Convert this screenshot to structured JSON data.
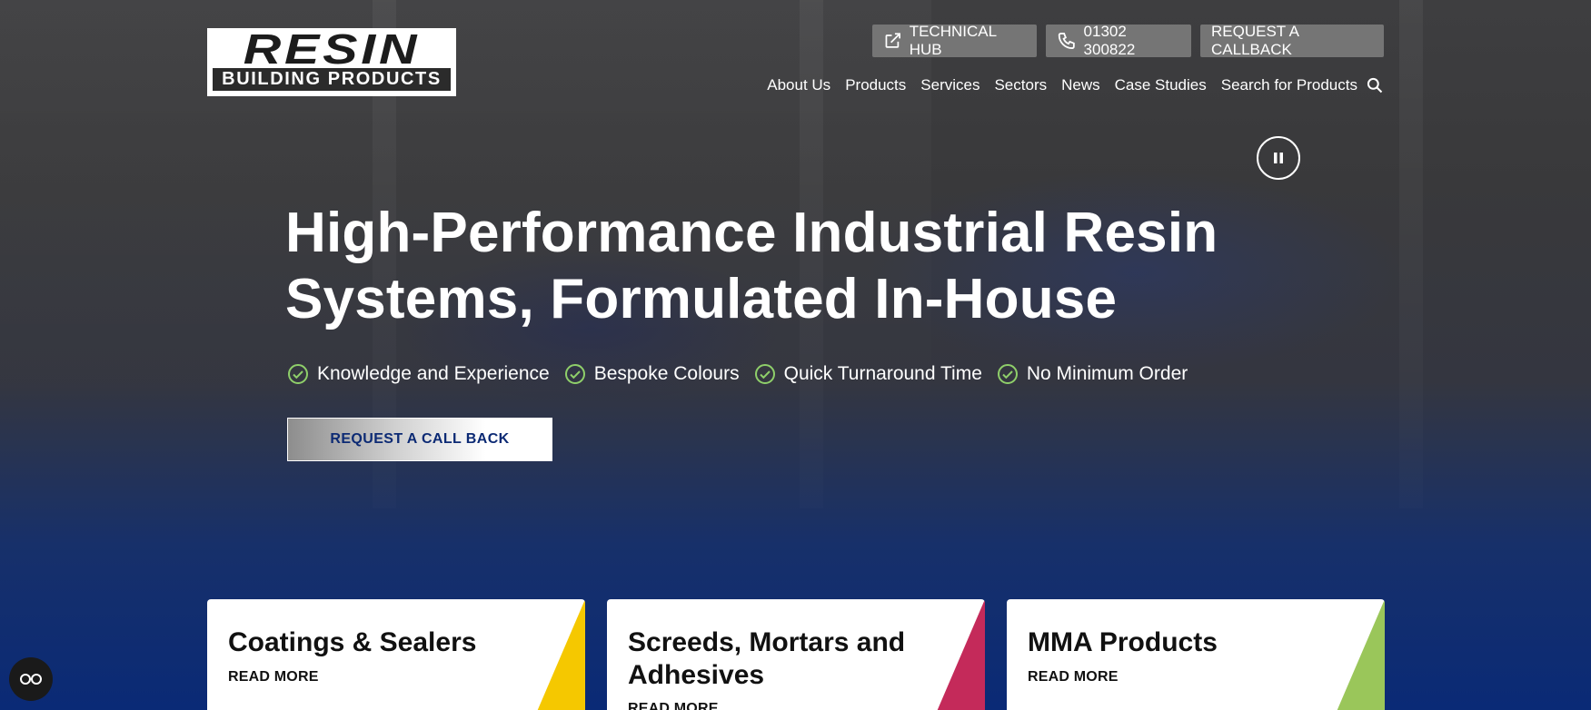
{
  "brand": {
    "logo_main": "RESIN",
    "logo_sub": "BUILDING PRODUCTS"
  },
  "utility": {
    "technical_hub": "TECHNICAL HUB",
    "phone": "01302 300822",
    "callback": "REQUEST A CALLBACK"
  },
  "nav": {
    "items": [
      {
        "label": "About Us"
      },
      {
        "label": "Products"
      },
      {
        "label": "Services"
      },
      {
        "label": "Sectors"
      },
      {
        "label": "News"
      },
      {
        "label": "Case Studies"
      },
      {
        "label": "Search for Products"
      }
    ]
  },
  "hero": {
    "headline_line1": "High-Performance Industrial Resin",
    "headline_line2": "Systems, Formulated In-House",
    "features": [
      {
        "label": "Knowledge and Experience"
      },
      {
        "label": "Bespoke Colours"
      },
      {
        "label": "Quick Turnaround Time"
      },
      {
        "label": "No Minimum Order"
      }
    ],
    "cta": "REQUEST A CALL BACK"
  },
  "cards": [
    {
      "title": "Coatings & Sealers",
      "link": "READ MORE",
      "accent": "#f5c800"
    },
    {
      "title": "Screeds, Mortars and Adhesives",
      "link": "READ MORE",
      "accent": "#c42a5a"
    },
    {
      "title": "MMA Products",
      "link": "READ MORE",
      "accent": "#9ac65a"
    }
  ],
  "colors": {
    "check": "#8fcf6a",
    "cta_text": "#0c2a74",
    "util_bg": "#757575"
  },
  "icons": {
    "technical_hub": "external-link-icon",
    "phone": "phone-icon",
    "search": "search-icon",
    "pause": "pause-icon",
    "feature": "check-circle-icon",
    "accessibility": "accessibility-icon"
  }
}
